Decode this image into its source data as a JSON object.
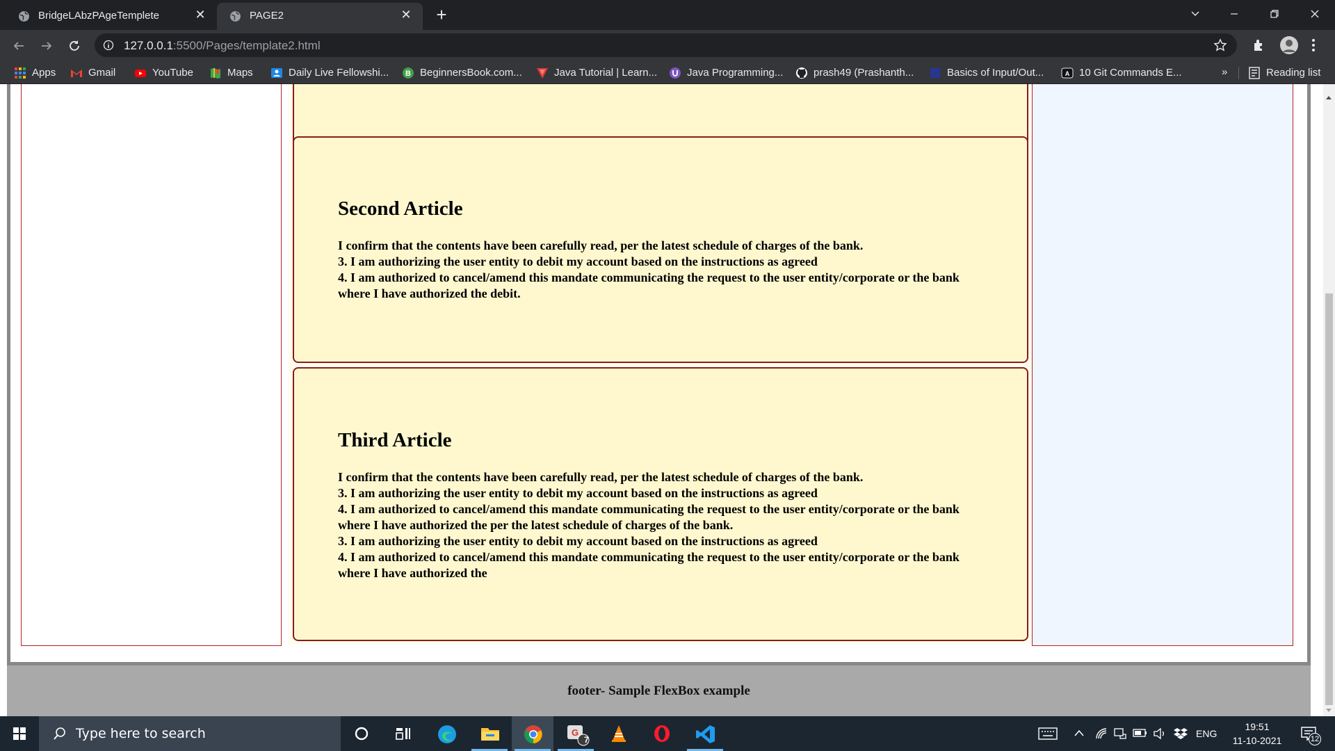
{
  "browser": {
    "tabs": [
      {
        "title": "BridgeLAbzPAgeTemplete",
        "active": false
      },
      {
        "title": "PAGE2",
        "active": true
      }
    ],
    "url_host": "127.0.0.1",
    "url_path": ":5500/Pages/template2.html",
    "bookmarks": [
      {
        "label": "Apps",
        "icon": "apps-grid-icon"
      },
      {
        "label": "Gmail",
        "icon": "gmail-icon"
      },
      {
        "label": "YouTube",
        "icon": "youtube-icon"
      },
      {
        "label": "Maps",
        "icon": "maps-icon"
      },
      {
        "label": "Daily Live Fellowshi...",
        "icon": "fellowship-icon"
      },
      {
        "label": "BeginnersBook.com...",
        "icon": "beginnersbook-icon"
      },
      {
        "label": "Java Tutorial | Learn...",
        "icon": "java-tutorial-icon"
      },
      {
        "label": "Java Programming...",
        "icon": "java-programming-icon"
      },
      {
        "label": "prash49 (Prashanth...",
        "icon": "github-icon"
      },
      {
        "label": "Basics of Input/Out...",
        "icon": "blank-page-icon"
      },
      {
        "label": "10 Git Commands E...",
        "icon": "git-commands-icon"
      }
    ],
    "overflow_label": "»",
    "reading_list_label": "Reading list"
  },
  "page": {
    "articles": [
      {
        "title": "Second Article",
        "lines": [
          "I confirm that the contents have been carefully read, per the latest schedule of charges of the bank.",
          "3. I am authorizing the user entity to debit my account based on the instructions as agreed",
          "4. I am authorized to cancel/amend this mandate communicating the request to the user entity/corporate or the bank where I have authorized the debit."
        ]
      },
      {
        "title": "Third Article",
        "lines": [
          "I confirm that the contents have been carefully read, per the latest schedule of charges of the bank.",
          "3. I am authorizing the user entity to debit my account based on the instructions as agreed",
          "4. I am authorized to cancel/amend this mandate communicating the request to the user entity/corporate or the bank where I have authorized the per the latest schedule of charges of the bank.",
          "3. I am authorizing the user entity to debit my account based on the instructions as agreed",
          "4. I am authorized to cancel/amend this mandate communicating the request to the user entity/corporate or the bank where I have authorized the"
        ]
      }
    ],
    "footer": "footer- Sample FlexBox example"
  },
  "taskbar": {
    "search_placeholder": "Type here to search",
    "apps": [
      "cortana-icon",
      "task-view-icon",
      "edge-icon",
      "file-explorer-icon",
      "chrome-icon",
      "gmail-app-icon",
      "vlc-icon",
      "opera-icon",
      "vscode-icon"
    ],
    "gmail_badge": "7",
    "language": "ENG",
    "time": "19:51",
    "date": "11-10-2021",
    "notification_count": "12"
  },
  "colors": {
    "article_bg": "#fff8cf",
    "article_border": "#8b1a1a",
    "aside_border": "#b22222",
    "footer_bg": "#a9a9a9"
  }
}
